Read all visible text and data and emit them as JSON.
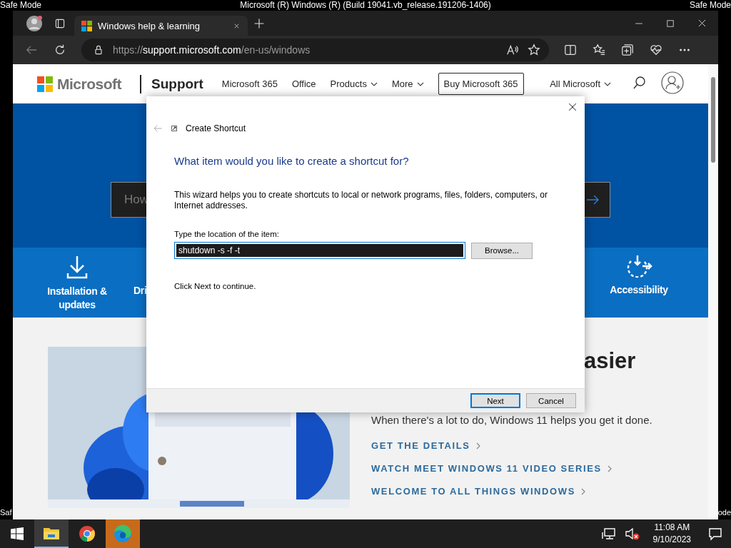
{
  "desktop": {
    "title": "Microsoft (R) Windows (R) (Build 19041.vb_release.191206-1406)",
    "top_left": "Safe Mode",
    "top_right": "Safe Mode",
    "bottom_left": "Saf",
    "bottom_right": "ode"
  },
  "browser": {
    "tabs": [
      {
        "title": "Windows help & learning",
        "selected": true
      }
    ],
    "url": {
      "scheme": "https://",
      "host": "support.microsoft.com",
      "path": "/en-us/windows"
    }
  },
  "page": {
    "brand": "Microsoft",
    "section": "Support",
    "nav": [
      {
        "label": "Microsoft 365",
        "dropdown": false
      },
      {
        "label": "Office",
        "dropdown": false
      },
      {
        "label": "Products",
        "dropdown": true
      },
      {
        "label": "More",
        "dropdown": true
      }
    ],
    "cta": "Buy Microsoft 365",
    "all_microsoft": "All Microsoft",
    "search": {
      "placeholder": "How"
    },
    "categories": [
      {
        "label": "Installation & updates",
        "kind": "download"
      },
      {
        "label": "Dri",
        "kind": "covered"
      },
      {
        "label": "Accessibility",
        "kind": "accessibility"
      }
    ],
    "feature": {
      "image": {
        "kind": "picture"
      },
      "heading": "asier",
      "text": "When there's a lot to do, Windows 11 helps you get it done.",
      "links": [
        "GET THE DETAILS",
        "WATCH MEET WINDOWS 11 VIDEO SERIES",
        "WELCOME TO ALL THINGS WINDOWS"
      ]
    }
  },
  "dialog": {
    "title": "Create Shortcut",
    "heading": "What item would you like to create a shortcut for?",
    "description": "This wizard helps you to create shortcuts to local or network programs, files, folders, computers, or Internet addresses.",
    "field_label": "Type the location of the item:",
    "value": "shutdown -s -f -t",
    "browse": "Browse...",
    "hint": "Click Next to continue.",
    "buttons": [
      {
        "label": "Next",
        "default": true
      },
      {
        "label": "Cancel",
        "default": false
      }
    ]
  },
  "taskbar": {
    "apps": [
      {
        "kind": "explorer",
        "active": true,
        "flashing": false
      },
      {
        "kind": "chrome",
        "active": false,
        "flashing": false
      },
      {
        "kind": "edge",
        "active": false,
        "flashing": true
      }
    ],
    "time": "11:08 AM",
    "date": "9/10/2023"
  }
}
